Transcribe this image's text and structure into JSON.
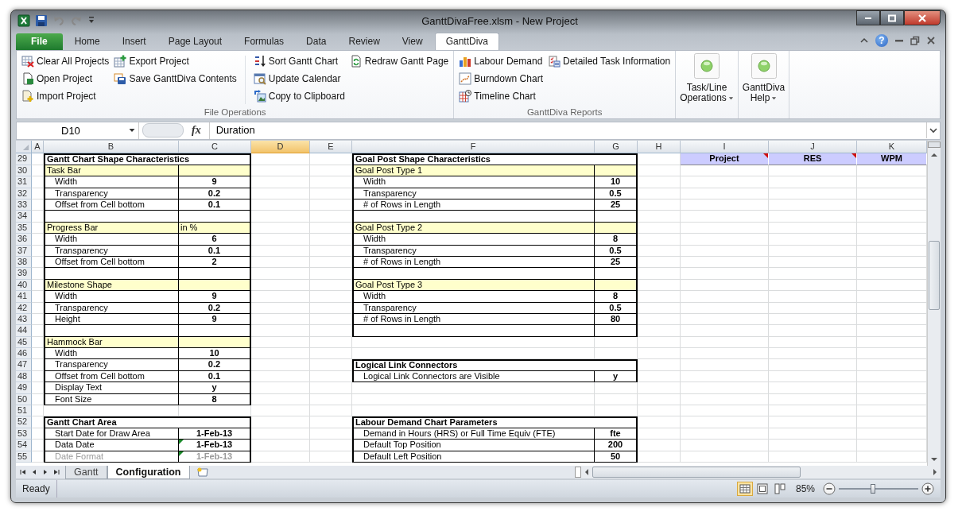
{
  "window": {
    "title": "GanttDivaFree.xlsm  -  New Project"
  },
  "ribbon_tabs": [
    {
      "label": "File",
      "kind": "file",
      "selected": false
    },
    {
      "label": "Home",
      "kind": "tab",
      "selected": false
    },
    {
      "label": "Insert",
      "kind": "tab",
      "selected": false
    },
    {
      "label": "Page Layout",
      "kind": "tab",
      "selected": false
    },
    {
      "label": "Formulas",
      "kind": "tab",
      "selected": false
    },
    {
      "label": "Data",
      "kind": "tab",
      "selected": false
    },
    {
      "label": "Review",
      "kind": "tab",
      "selected": false
    },
    {
      "label": "View",
      "kind": "tab",
      "selected": false
    },
    {
      "label": "GanttDiva",
      "kind": "tab",
      "selected": true
    }
  ],
  "help_button": "?",
  "ribbon_groups": [
    {
      "kind": "small",
      "label": "File Operations",
      "columns": [
        {
          "separator": false,
          "items": [
            {
              "label": "Clear All Projects"
            },
            {
              "label": "Open Project"
            },
            {
              "label": "Import Project"
            }
          ]
        },
        {
          "separator": false,
          "items": [
            {
              "label": "Export Project"
            },
            {
              "label": "Save GanttDiva Contents"
            }
          ]
        },
        {
          "separator": true,
          "items": [
            {
              "label": "Sort Gantt Chart"
            },
            {
              "label": "Update Calendar"
            },
            {
              "label": "Copy to Clipboard"
            }
          ]
        },
        {
          "separator": false,
          "items": [
            {
              "label": "Redraw Gantt Page"
            }
          ]
        }
      ]
    },
    {
      "kind": "small",
      "label": "GanttDiva Reports",
      "columns": [
        {
          "separator": false,
          "items": [
            {
              "label": "Labour Demand"
            },
            {
              "label": "Burndown Chart"
            },
            {
              "label": "Timeline Chart"
            }
          ]
        },
        {
          "separator": false,
          "items": [
            {
              "label": "Detailed Task Information"
            }
          ]
        }
      ]
    },
    {
      "kind": "large",
      "lines": [
        "Task/Line",
        "Operations"
      ],
      "dropdown": true
    },
    {
      "kind": "large",
      "lines": [
        "GanttDiva",
        "Help"
      ],
      "dropdown": true
    }
  ],
  "formula_bar": {
    "name_box": "D10",
    "function_label": "fx",
    "value": "Duration"
  },
  "columns": [
    {
      "label": "A",
      "selected": false
    },
    {
      "label": "B",
      "selected": false
    },
    {
      "label": "C",
      "selected": false
    },
    {
      "label": "D",
      "selected": true
    },
    {
      "label": "E",
      "selected": false
    },
    {
      "label": "F",
      "selected": false
    },
    {
      "label": "G",
      "selected": false
    },
    {
      "label": "H",
      "selected": false
    },
    {
      "label": "I",
      "selected": false
    },
    {
      "label": "J",
      "selected": false
    },
    {
      "label": "K",
      "selected": false
    }
  ],
  "rows": [
    {
      "number": "29",
      "cells": [
        {
          "kind": "empty"
        },
        {
          "kind": "title",
          "text": "Gantt Chart Shape Characteristics"
        },
        {
          "kind": "blank"
        },
        {
          "kind": "empty"
        },
        {
          "kind": "empty"
        },
        {
          "kind": "title",
          "text": "Goal Post Shape Characteristics"
        },
        {
          "kind": "blank"
        },
        {
          "kind": "empty"
        },
        {
          "kind": "header",
          "text": "Project",
          "comment": true
        },
        {
          "kind": "header",
          "text": "RES",
          "comment": true
        },
        {
          "kind": "header",
          "text": "WPM",
          "comment": false
        }
      ]
    },
    {
      "number": "30",
      "cells": [
        {
          "kind": "empty"
        },
        {
          "kind": "section",
          "text": "Task Bar"
        },
        {
          "kind": "section"
        },
        {
          "kind": "empty"
        },
        {
          "kind": "empty"
        },
        {
          "kind": "section",
          "text": "Goal Post Type 1"
        },
        {
          "kind": "section"
        }
      ]
    },
    {
      "number": "31",
      "cells": [
        {
          "kind": "empty"
        },
        {
          "kind": "label",
          "text": "Width"
        },
        {
          "kind": "value",
          "text": "9"
        },
        {
          "kind": "empty"
        },
        {
          "kind": "empty"
        },
        {
          "kind": "label",
          "text": "Width"
        },
        {
          "kind": "value",
          "text": "10"
        }
      ]
    },
    {
      "number": "32",
      "cells": [
        {
          "kind": "empty"
        },
        {
          "kind": "label",
          "text": "Transparency"
        },
        {
          "kind": "value",
          "text": "0.2"
        },
        {
          "kind": "empty"
        },
        {
          "kind": "empty"
        },
        {
          "kind": "label",
          "text": "Transparency"
        },
        {
          "kind": "value",
          "text": "0.5"
        }
      ]
    },
    {
      "number": "33",
      "cells": [
        {
          "kind": "empty"
        },
        {
          "kind": "label",
          "text": "Offset from Cell bottom"
        },
        {
          "kind": "value",
          "text": "0.1"
        },
        {
          "kind": "empty"
        },
        {
          "kind": "empty"
        },
        {
          "kind": "label",
          "text": "# of Rows in Length"
        },
        {
          "kind": "value",
          "text": "25"
        }
      ]
    },
    {
      "number": "34",
      "cells": [
        {
          "kind": "empty"
        },
        {
          "kind": "blank"
        },
        {
          "kind": "blank"
        },
        {
          "kind": "empty"
        },
        {
          "kind": "empty"
        },
        {
          "kind": "blank"
        },
        {
          "kind": "blank"
        }
      ]
    },
    {
      "number": "35",
      "cells": [
        {
          "kind": "empty"
        },
        {
          "kind": "section",
          "text": "Progress Bar"
        },
        {
          "kind": "section",
          "text": "in %"
        },
        {
          "kind": "empty"
        },
        {
          "kind": "empty"
        },
        {
          "kind": "section",
          "text": "Goal Post Type 2"
        },
        {
          "kind": "section"
        }
      ]
    },
    {
      "number": "36",
      "cells": [
        {
          "kind": "empty"
        },
        {
          "kind": "label",
          "text": "Width"
        },
        {
          "kind": "value",
          "text": "6"
        },
        {
          "kind": "empty"
        },
        {
          "kind": "empty"
        },
        {
          "kind": "label",
          "text": "Width"
        },
        {
          "kind": "value",
          "text": "8"
        }
      ]
    },
    {
      "number": "37",
      "cells": [
        {
          "kind": "empty"
        },
        {
          "kind": "label",
          "text": "Transparency"
        },
        {
          "kind": "value",
          "text": "0.1"
        },
        {
          "kind": "empty"
        },
        {
          "kind": "empty"
        },
        {
          "kind": "label",
          "text": "Transparency"
        },
        {
          "kind": "value",
          "text": "0.5"
        }
      ]
    },
    {
      "number": "38",
      "cells": [
        {
          "kind": "empty"
        },
        {
          "kind": "label",
          "text": "Offset from Cell bottom"
        },
        {
          "kind": "value",
          "text": "2"
        },
        {
          "kind": "empty"
        },
        {
          "kind": "empty"
        },
        {
          "kind": "label",
          "text": "# of Rows in Length"
        },
        {
          "kind": "value",
          "text": "25"
        }
      ]
    },
    {
      "number": "39",
      "cells": [
        {
          "kind": "empty"
        },
        {
          "kind": "blank"
        },
        {
          "kind": "blank"
        },
        {
          "kind": "empty"
        },
        {
          "kind": "empty"
        },
        {
          "kind": "blank"
        },
        {
          "kind": "blank"
        }
      ]
    },
    {
      "number": "40",
      "cells": [
        {
          "kind": "empty"
        },
        {
          "kind": "section",
          "text": "Milestone Shape"
        },
        {
          "kind": "section"
        },
        {
          "kind": "empty"
        },
        {
          "kind": "empty"
        },
        {
          "kind": "section",
          "text": "Goal Post Type 3"
        },
        {
          "kind": "section"
        }
      ]
    },
    {
      "number": "41",
      "cells": [
        {
          "kind": "empty"
        },
        {
          "kind": "label",
          "text": "Width"
        },
        {
          "kind": "value",
          "text": "9"
        },
        {
          "kind": "empty"
        },
        {
          "kind": "empty"
        },
        {
          "kind": "label",
          "text": "Width"
        },
        {
          "kind": "value",
          "text": "8"
        }
      ]
    },
    {
      "number": "42",
      "cells": [
        {
          "kind": "empty"
        },
        {
          "kind": "label",
          "text": "Transparency"
        },
        {
          "kind": "value",
          "text": "0.2"
        },
        {
          "kind": "empty"
        },
        {
          "kind": "empty"
        },
        {
          "kind": "label",
          "text": "Transparency"
        },
        {
          "kind": "value",
          "text": "0.5"
        }
      ]
    },
    {
      "number": "43",
      "cells": [
        {
          "kind": "empty"
        },
        {
          "kind": "label",
          "text": "Height"
        },
        {
          "kind": "value",
          "text": "9"
        },
        {
          "kind": "empty"
        },
        {
          "kind": "empty"
        },
        {
          "kind": "label",
          "text": "# of Rows in Length"
        },
        {
          "kind": "value",
          "text": "80"
        }
      ]
    },
    {
      "number": "44",
      "cells": [
        {
          "kind": "empty"
        },
        {
          "kind": "blank"
        },
        {
          "kind": "blank"
        },
        {
          "kind": "empty"
        },
        {
          "kind": "empty"
        },
        {
          "kind": "blank"
        },
        {
          "kind": "blank"
        }
      ]
    },
    {
      "number": "45",
      "cells": [
        {
          "kind": "empty"
        },
        {
          "kind": "section",
          "text": "Hammock Bar"
        },
        {
          "kind": "section"
        }
      ]
    },
    {
      "number": "46",
      "cells": [
        {
          "kind": "empty"
        },
        {
          "kind": "label",
          "text": "Width"
        },
        {
          "kind": "value",
          "text": "10"
        }
      ]
    },
    {
      "number": "47",
      "cells": [
        {
          "kind": "empty"
        },
        {
          "kind": "label",
          "text": "Transparency"
        },
        {
          "kind": "value",
          "text": "0.2"
        },
        {
          "kind": "empty"
        },
        {
          "kind": "empty"
        },
        {
          "kind": "title",
          "text": "Logical Link Connectors"
        },
        {
          "kind": "blank"
        }
      ]
    },
    {
      "number": "48",
      "cells": [
        {
          "kind": "empty"
        },
        {
          "kind": "label",
          "text": "Offset from Cell bottom"
        },
        {
          "kind": "value",
          "text": "0.1"
        },
        {
          "kind": "empty"
        },
        {
          "kind": "empty"
        },
        {
          "kind": "label",
          "text": "Logical Link Connectors are Visible"
        },
        {
          "kind": "value",
          "text": "y"
        }
      ]
    },
    {
      "number": "49",
      "cells": [
        {
          "kind": "empty"
        },
        {
          "kind": "label",
          "text": "Display Text"
        },
        {
          "kind": "value",
          "text": "y"
        }
      ]
    },
    {
      "number": "50",
      "cells": [
        {
          "kind": "empty"
        },
        {
          "kind": "label",
          "text": "Font Size"
        },
        {
          "kind": "value",
          "text": "8"
        }
      ]
    },
    {
      "number": "51",
      "cells": []
    },
    {
      "number": "52",
      "cells": [
        {
          "kind": "empty"
        },
        {
          "kind": "title",
          "text": "Gantt Chart Area"
        },
        {
          "kind": "blank"
        },
        {
          "kind": "empty"
        },
        {
          "kind": "empty"
        },
        {
          "kind": "title",
          "text": "Labour Demand Chart Parameters"
        },
        {
          "kind": "blank"
        }
      ]
    },
    {
      "number": "53",
      "cells": [
        {
          "kind": "empty"
        },
        {
          "kind": "label",
          "text": "Start Date for Draw Area",
          "dim": false
        },
        {
          "kind": "value",
          "text": "1-Feb-13",
          "dim": false,
          "flag": false
        },
        {
          "kind": "empty"
        },
        {
          "kind": "empty"
        },
        {
          "kind": "label",
          "text": "Demand in Hours (HRS) or Full Time Equiv (FTE)"
        },
        {
          "kind": "value",
          "text": "fte"
        }
      ]
    },
    {
      "number": "54",
      "cells": [
        {
          "kind": "empty"
        },
        {
          "kind": "label",
          "text": "Data Date",
          "dim": false
        },
        {
          "kind": "value",
          "text": "1-Feb-13",
          "dim": false,
          "flag": true
        },
        {
          "kind": "empty"
        },
        {
          "kind": "empty"
        },
        {
          "kind": "label",
          "text": "Default Top Position"
        },
        {
          "kind": "value",
          "text": "200"
        }
      ]
    },
    {
      "number": "55",
      "cells": [
        {
          "kind": "empty"
        },
        {
          "kind": "label",
          "text": "Date Format",
          "dim": true
        },
        {
          "kind": "value",
          "text": "1-Feb-13",
          "dim": true,
          "flag": true
        },
        {
          "kind": "empty"
        },
        {
          "kind": "empty"
        },
        {
          "kind": "label",
          "text": "Default Left Position"
        },
        {
          "kind": "value",
          "text": "50"
        }
      ]
    }
  ],
  "sheet_tabs": [
    {
      "label": "Gantt",
      "selected": false
    },
    {
      "label": "Configuration",
      "selected": true
    }
  ],
  "status_bar": {
    "status": "Ready",
    "views": [
      {
        "selected": true
      },
      {
        "selected": false
      },
      {
        "selected": false
      }
    ],
    "zoom": {
      "label": "85%",
      "level": 0.43
    }
  }
}
